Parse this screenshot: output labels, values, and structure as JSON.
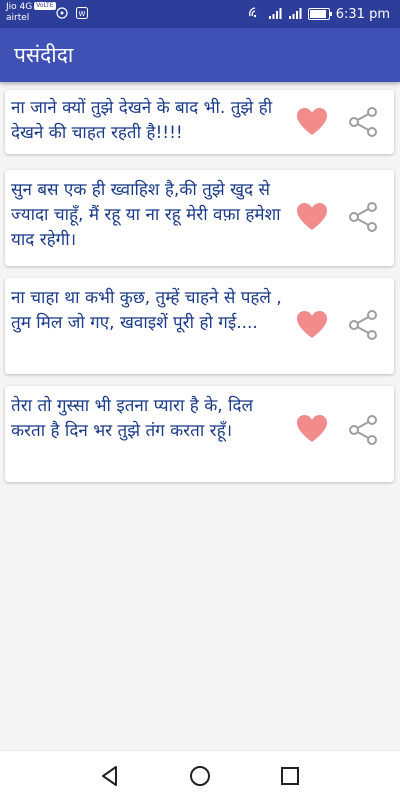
{
  "status_bar": {
    "carrier_line1": "Jio 4G",
    "volte": "VoLTE",
    "carrier_line2": "airtel",
    "time": "6:31 pm",
    "battery_level": 0.9
  },
  "app_bar": {
    "title": "पसंदीदा"
  },
  "cards": [
    {
      "text": "ना जाने क्यों तुझे देखने के बाद भी. तुझे ही देखने की चाहत रहती है!!!!"
    },
    {
      "text": "सुन बस एक ही ख्वाहिश है,की तुझे खुद से ज्यादा चाहूँ, मैं रहू या ना रहू मेरी वफ़ा हमेशा याद रहेगी।"
    },
    {
      "text": "ना चाहा था कभी कुछ, तुम्हें चाहने से पहले , तुम मिल जो गए, खवाइशें पूरी हो गई...."
    },
    {
      "text": "तेरा तो गुस्सा भी इतना प्यारा है के, दिल करता है दिन भर तुझे तंग करता रहूँ।"
    }
  ],
  "colors": {
    "status_bar": "#2d3e9a",
    "app_bar": "#3f51b5",
    "text": "#1a3b8a",
    "heart": "#f28b8b",
    "share": "#9e9e9e"
  },
  "icons": {
    "favorite": "heart-icon",
    "share": "share-icon",
    "back": "back-icon",
    "home": "home-icon",
    "recents": "recents-icon"
  }
}
